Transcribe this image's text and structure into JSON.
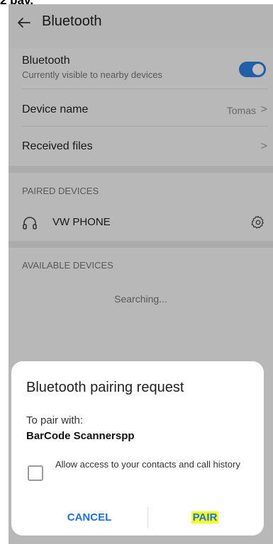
{
  "frame_label": "2 pav.",
  "header": {
    "title": "Bluetooth"
  },
  "bluetooth": {
    "title": "Bluetooth",
    "subtitle": "Currently visible to nearby devices",
    "enabled": true,
    "accent_color": "#2f7ee0"
  },
  "settings_rows": [
    {
      "label": "Device name",
      "value": "Tomas",
      "chevron": ">"
    },
    {
      "label": "Received files",
      "value": "",
      "chevron": ">"
    }
  ],
  "paired": {
    "header": "PAIRED DEVICES",
    "devices": [
      {
        "name": "VW PHONE",
        "icon": "headphones-icon"
      }
    ]
  },
  "available": {
    "header": "AVAILABLE DEVICES",
    "status": "Searching..."
  },
  "dialog": {
    "title": "Bluetooth pairing request",
    "pair_with": "To pair with:",
    "device_name": "BarCode Scannerspp",
    "checkbox_label": "Allow access to your contacts and call history",
    "checkbox_checked": false,
    "cancel_label": "CANCEL",
    "pair_label": "PAIR",
    "pair_highlight_color": "#f4ff26"
  }
}
